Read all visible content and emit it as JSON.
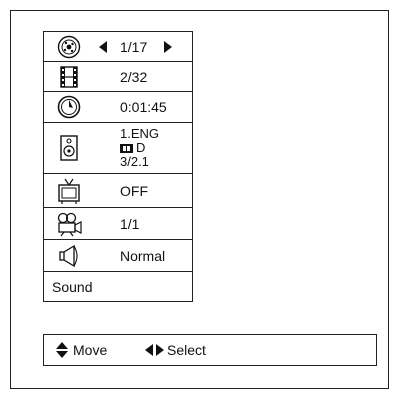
{
  "menu": {
    "items": [
      {
        "icon": "disc-title-icon",
        "value": "1/17"
      },
      {
        "icon": "film-chapter-icon",
        "value": "2/32"
      },
      {
        "icon": "clock-time-icon",
        "value": "0:01:45"
      },
      {
        "icon": "speaker-audio-icon",
        "lines": [
          "1.ENG",
          "D",
          "3/2.1"
        ]
      },
      {
        "icon": "tv-subtitle-icon",
        "value": "OFF"
      },
      {
        "icon": "camera-angle-icon",
        "value": "1/1"
      },
      {
        "icon": "speaker-sound-icon",
        "value": "Normal"
      },
      {
        "label": "Sound"
      }
    ]
  },
  "hints": {
    "move": "Move",
    "select": "Select"
  }
}
